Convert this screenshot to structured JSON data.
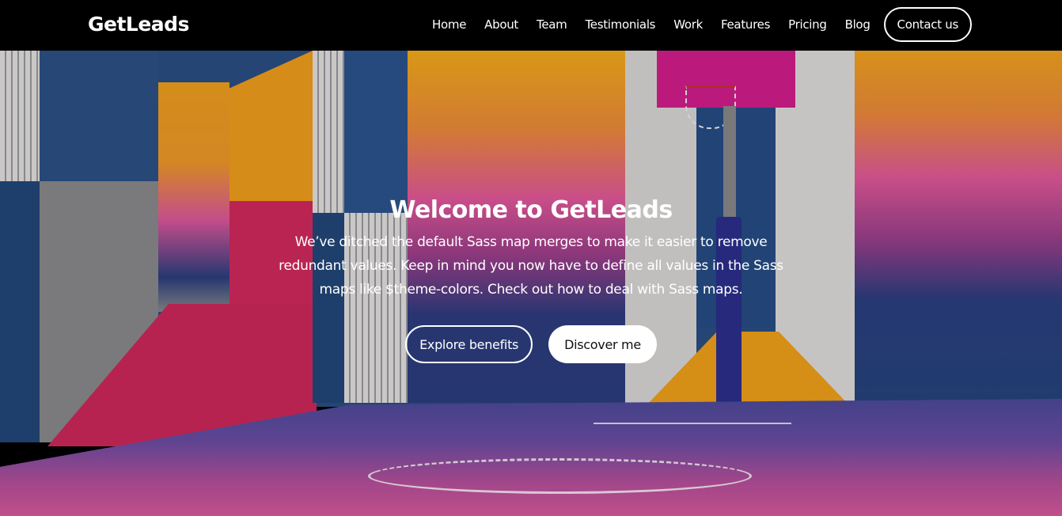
{
  "navbar": {
    "brand": "GetLeads",
    "links": [
      "Home",
      "About",
      "Team",
      "Testimonials",
      "Work",
      "Features",
      "Pricing",
      "Blog"
    ],
    "contact_label": "Contact us"
  },
  "hero": {
    "title": "Welcome to GetLeads",
    "description": "We’ve ditched the default Sass map merges to make it easier to remove redundant values. Keep in mind you now have to define all values in the Sass maps like $theme-colors. Check out how to deal with Sass maps.",
    "primary_button": "Explore benefits",
    "secondary_button": "Discover me",
    "background_image": "colorful-basketball-court-photo"
  }
}
